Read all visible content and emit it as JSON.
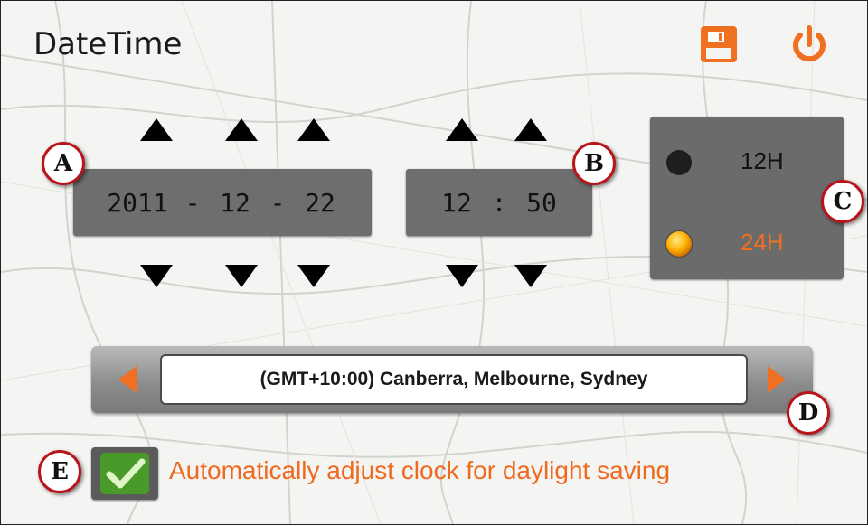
{
  "window": {
    "title": "DateTime"
  },
  "toolbar": {
    "save_icon": "floppy-disk-icon",
    "power_icon": "power-icon",
    "accent_color": "#f07021"
  },
  "date": {
    "year": "2011",
    "month": "12",
    "day": "22",
    "separator": "-"
  },
  "time": {
    "hour": "12",
    "minute": "50",
    "separator": ":"
  },
  "time_format": {
    "options": [
      {
        "label": "12H",
        "selected": false
      },
      {
        "label": "24H",
        "selected": true
      }
    ]
  },
  "timezone": {
    "value": "(GMT+10:00) Canberra, Melbourne, Sydney"
  },
  "daylight": {
    "label": "Automatically adjust clock for daylight saving",
    "checked": true
  },
  "callouts": [
    "A",
    "B",
    "C",
    "D",
    "E"
  ]
}
